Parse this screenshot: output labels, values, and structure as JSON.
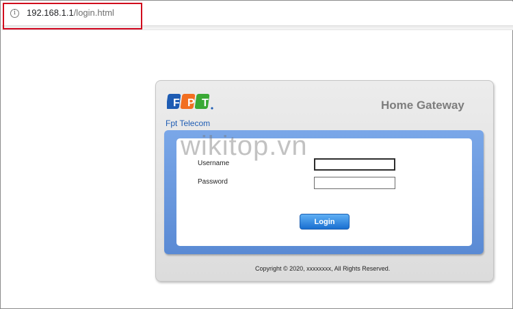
{
  "browser": {
    "url_host": "192.168.1.1",
    "url_path": "/login.html",
    "info_icon": "info-icon"
  },
  "branding": {
    "logo_letters": [
      "F",
      "P",
      "T"
    ],
    "logo_text": "Fpt Telecom",
    "title": "Home Gateway"
  },
  "watermark": "wikitop.vn",
  "form": {
    "username_label": "Username",
    "username_value": "",
    "password_label": "Password",
    "password_value": "",
    "login_label": "Login"
  },
  "footer": {
    "copyright": "Copyright © 2020, xxxxxxxx, All Rights Reserved."
  },
  "colors": {
    "highlight": "#d0021b",
    "fpt_blue": "#1e5cb3",
    "fpt_orange": "#f26f21",
    "fpt_green": "#3aa935",
    "panel_blue": "#6a98de",
    "button_blue": "#1a6fd0"
  }
}
